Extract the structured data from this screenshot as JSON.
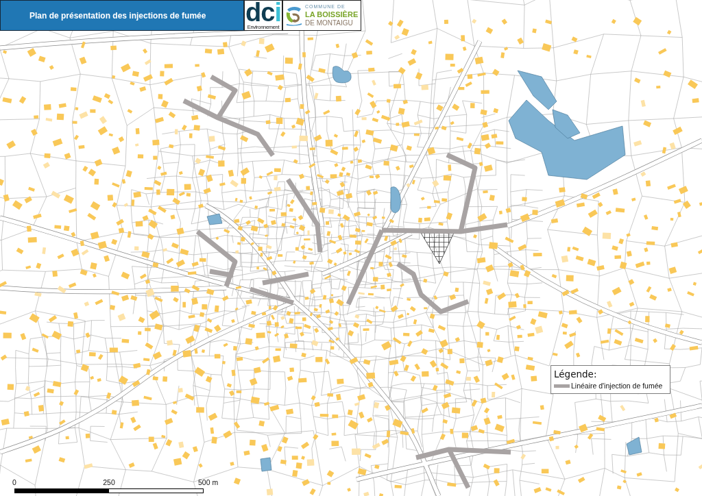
{
  "title_bar": {
    "title": "Plan de présentation des injections de fumée"
  },
  "logos": [
    {
      "kind": "wordmark",
      "mark": "dci",
      "caption": "Environnement"
    },
    {
      "kind": "commune",
      "lines": [
        "COMMUNE DE",
        "LA BOISSIÈRE",
        "DE MONTAIGU"
      ]
    }
  ],
  "legend": {
    "title": "Légende:",
    "items": [
      {
        "label": "Linéaire d'injection de fumée",
        "color": "#a8a3a3"
      }
    ]
  },
  "scale_bar": {
    "labels": [
      "0",
      "250",
      "500 m"
    ]
  }
}
